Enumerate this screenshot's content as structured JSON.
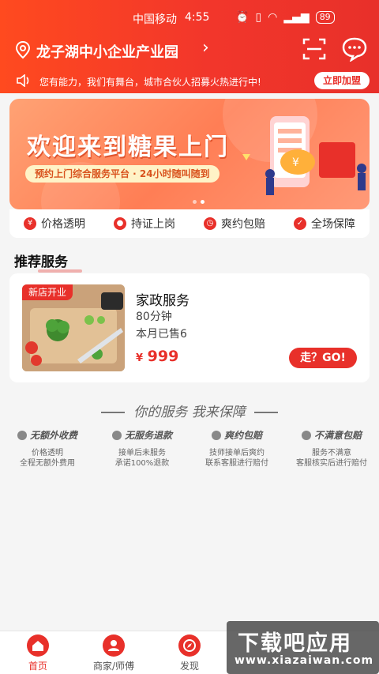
{
  "status_bar": {
    "carrier": "中国移动",
    "time": "4:55",
    "battery": "89"
  },
  "header": {
    "location": "龙子湖中小企业产业园"
  },
  "notice": {
    "text": "您有能力，我们有舞台，城市合伙人招募火热进行中!",
    "join_label": "立即加盟"
  },
  "banner": {
    "title": "欢迎来到糖果上门",
    "subtitle": "预约上门综合服务平台 · 24小时随叫随到"
  },
  "features": [
    {
      "label": "价格透明"
    },
    {
      "label": "持证上岗"
    },
    {
      "label": "爽约包赔"
    },
    {
      "label": "全场保障"
    }
  ],
  "section": {
    "title": "推荐服务"
  },
  "service": {
    "tag": "新店开业",
    "name": "家政服务",
    "duration": "80分钟",
    "sold": "本月已售6",
    "currency": "¥",
    "price": "999",
    "go_label": "走？GO!"
  },
  "guarantee": {
    "title": "你的服务 我来保障",
    "items": [
      {
        "title": "无额外收费",
        "line1": "价格透明",
        "line2": "全程无额外费用"
      },
      {
        "title": "无服务退款",
        "line1": "接单后未服务",
        "line2": "承诺100%退款"
      },
      {
        "title": "爽约包赔",
        "line1": "技师接单后爽约",
        "line2": "联系客服进行赔付"
      },
      {
        "title": "不满意包赔",
        "line1": "服务不满意",
        "line2": "客服核实后进行赔付"
      }
    ]
  },
  "bottom_nav": [
    {
      "label": "首页",
      "active": true
    },
    {
      "label": "商家/师傅"
    },
    {
      "label": "发现"
    }
  ],
  "watermark": {
    "line1": "下载吧应用",
    "line2": "www.xiazaiwan.com"
  },
  "colors": {
    "primary": "#e8302a",
    "header_start": "#ff4a1f"
  }
}
